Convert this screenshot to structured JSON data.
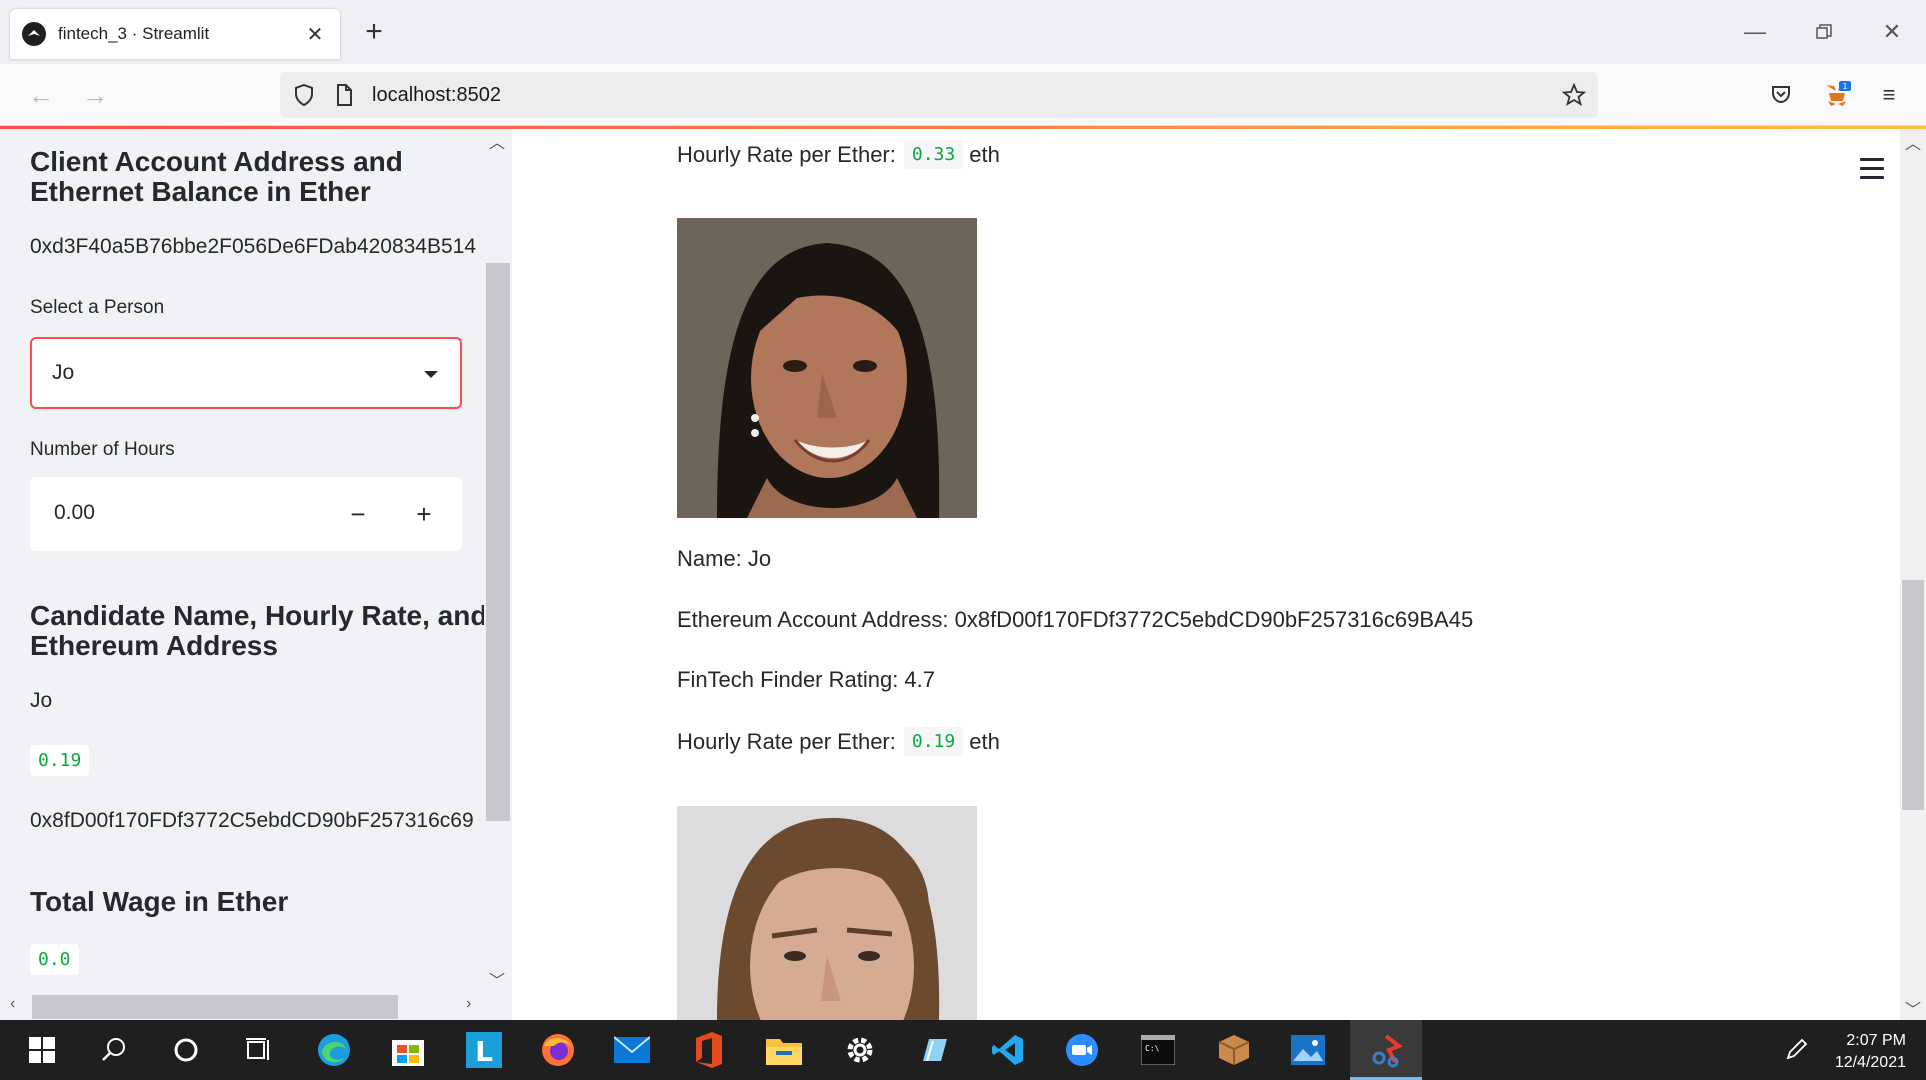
{
  "browser": {
    "tab_title": "fintech_3 · Streamlit",
    "url": "localhost:8502"
  },
  "sidebar": {
    "client_heading": "Client Account Address and Ethernet Balance in Ether",
    "client_address": "0xd3F40a5B76bbe2F056De6FDab420834B514",
    "select_label": "Select a Person",
    "select_value": "Jo",
    "hours_label": "Number of Hours",
    "hours_value": "0.00",
    "minus": "−",
    "plus": "+",
    "candidate_heading": "Candidate Name, Hourly Rate, and Ethereum Address",
    "candidate_name": "Jo",
    "candidate_rate": "0.19",
    "candidate_address": "0x8fD00f170FDf3772C5ebdCD90bF257316c69",
    "wage_heading": "Total Wage in Ether",
    "wage_value": "0.0"
  },
  "main": {
    "top_rate_label": "Hourly Rate per Ether:",
    "top_rate_value": "0.33",
    "top_rate_unit": "eth",
    "jo_name": "Name: Jo",
    "jo_address": "Ethereum Account Address: 0x8fD00f170FDf3772C5ebdCD90bF257316c69BA45",
    "jo_rating": "FinTech Finder Rating: 4.7",
    "jo_rate_label": "Hourly Rate per Ether:",
    "jo_rate_value": "0.19",
    "jo_rate_unit": "eth"
  },
  "taskbar": {
    "time": "2:07 PM",
    "date": "12/4/2021",
    "icons": [
      "windows-start",
      "search",
      "cortana",
      "task-view",
      "edge",
      "store",
      "l-app",
      "firefox",
      "mail",
      "office",
      "file-explorer",
      "settings",
      "notepad",
      "vscode",
      "zoom",
      "terminal",
      "package",
      "photos",
      "snip"
    ]
  },
  "colors": {
    "accent": "#ff4b4b",
    "code_green": "#09ab3b",
    "sidebar_bg": "#f0f2f6"
  }
}
